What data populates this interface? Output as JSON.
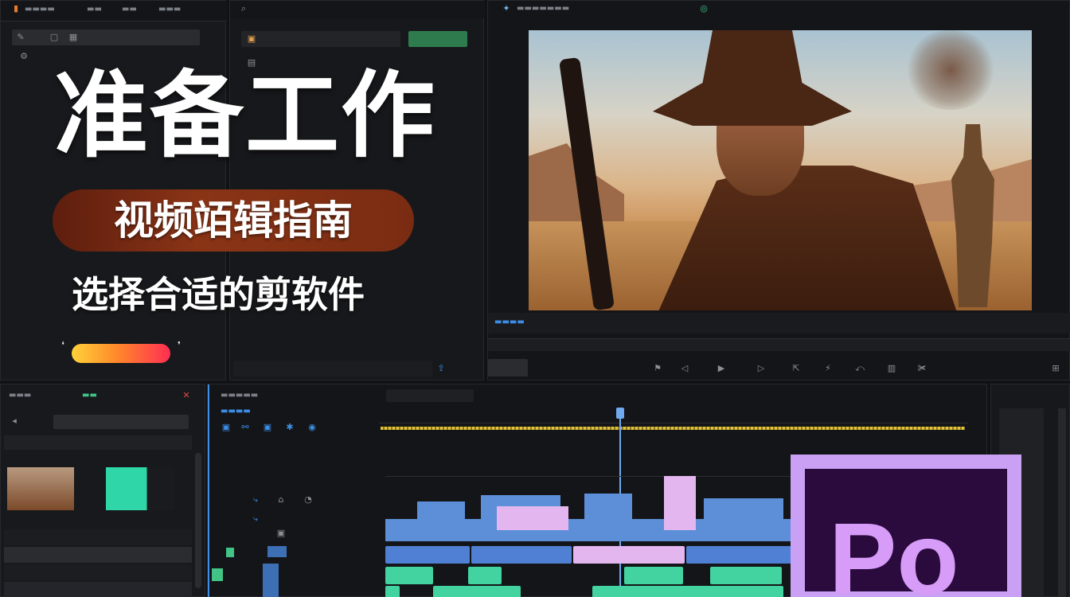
{
  "hero": {
    "title": "准备工作",
    "pill": "视频竡辑指南",
    "subtitle": "选择合适的剪软件"
  },
  "pr_logo": {
    "text": "Po"
  },
  "colors": {
    "accent_blue": "#3c8ee6",
    "pill": "#7a2c12",
    "pr_frame": "#c9a0f4",
    "pr_bg": "#2b0b3e",
    "audio_blue": "#5d8ed8",
    "audio_pink": "#e3b6ef",
    "clip_green": "#42d3a0"
  },
  "icons": [
    "search-icon",
    "close-icon",
    "play-icon",
    "marker-icon",
    "scissors-icon",
    "settings-icon",
    "folder-icon"
  ],
  "timeline": {
    "playhead_fraction": 0.4
  }
}
